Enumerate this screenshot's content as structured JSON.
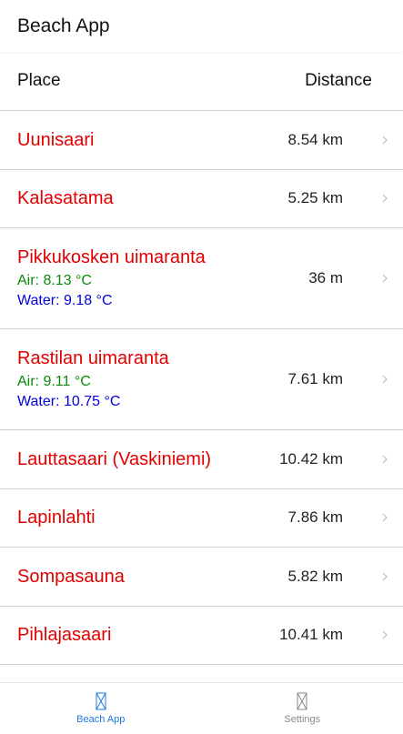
{
  "appbar": {
    "title": "Beach App"
  },
  "header": {
    "place": "Place",
    "distance": "Distance"
  },
  "beaches": [
    {
      "name": "Uunisaari",
      "distance": "8.54 km"
    },
    {
      "name": "Kalasatama",
      "distance": "5.25 km"
    },
    {
      "name": "Pikkukosken uimaranta",
      "air": "Air: 8.13 °C",
      "water": "Water: 9.18 °C",
      "distance": "36 m"
    },
    {
      "name": "Rastilan uimaranta",
      "air": "Air: 9.11 °C",
      "water": "Water: 10.75 °C",
      "distance": "7.61 km"
    },
    {
      "name": "Lauttasaari (Vaskiniemi)",
      "distance": "10.42 km"
    },
    {
      "name": "Lapinlahti",
      "distance": "7.86 km"
    },
    {
      "name": "Sompasauna",
      "distance": "5.82 km"
    },
    {
      "name": "Pihlajasaari",
      "distance": "10.41 km"
    }
  ],
  "tabs": [
    {
      "label": "Beach App",
      "icon": "beach-app-tab-icon",
      "active": true
    },
    {
      "label": "Settings",
      "icon": "settings-tab-icon",
      "active": false
    }
  ],
  "colors": {
    "place": "#e00000",
    "air": "#0a8a0a",
    "water": "#0000e0",
    "active_tab": "#1e7be0",
    "inactive_tab": "#8a8a8a"
  }
}
